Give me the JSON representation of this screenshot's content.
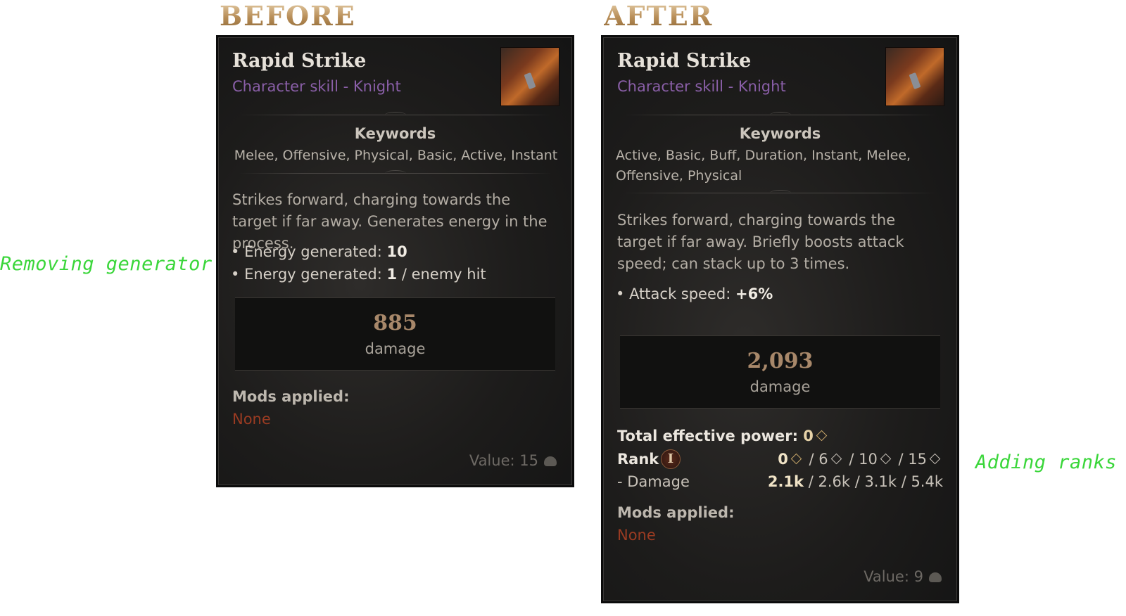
{
  "headings": {
    "before": "BEFORE",
    "after": "AFTER"
  },
  "notes": {
    "left": "Removing generator",
    "right": "Adding ranks"
  },
  "before": {
    "title": "Rapid Strike",
    "subtitle": "Character skill - Knight",
    "keywords_heading": "Keywords",
    "keywords": "Melee, Offensive, Physical, Basic, Active, Instant",
    "description": "Strikes forward, charging towards the target if far away. Generates energy in the process.",
    "bullets": [
      {
        "label": "Energy generated:",
        "value": "10",
        "suffix": ""
      },
      {
        "label": "Energy generated:",
        "value": "1",
        "suffix": "/ enemy hit"
      }
    ],
    "damage_value": "885",
    "damage_label": "damage",
    "mods_heading": "Mods applied:",
    "mods_value": "None",
    "value_label": "Value:",
    "value_amount": "15"
  },
  "after": {
    "title": "Rapid Strike",
    "subtitle": "Character skill - Knight",
    "keywords_heading": "Keywords",
    "keywords": "Active, Basic, Buff, Duration, Instant, Melee, Offensive, Physical",
    "description": "Strikes forward, charging towards the target if far away. Briefly boosts attack speed; can stack up to 3 times.",
    "bullet": {
      "label": "Attack speed:",
      "value": "+6%"
    },
    "damage_value": "2,093",
    "damage_label": "damage",
    "power_label": "Total effective power:",
    "power_value": "0",
    "rank_label": "Rank",
    "rank_badge": "I",
    "rank_thresholds": [
      "0",
      "/ 6",
      "/ 10",
      "/ 15"
    ],
    "damage_row_label": "- Damage",
    "damage_ranks": [
      "2.1k",
      "/ 2.6k",
      "/ 3.1k",
      "/ 5.4k"
    ],
    "mods_heading": "Mods applied:",
    "mods_value": "None",
    "value_label": "Value:",
    "value_amount": "9"
  }
}
